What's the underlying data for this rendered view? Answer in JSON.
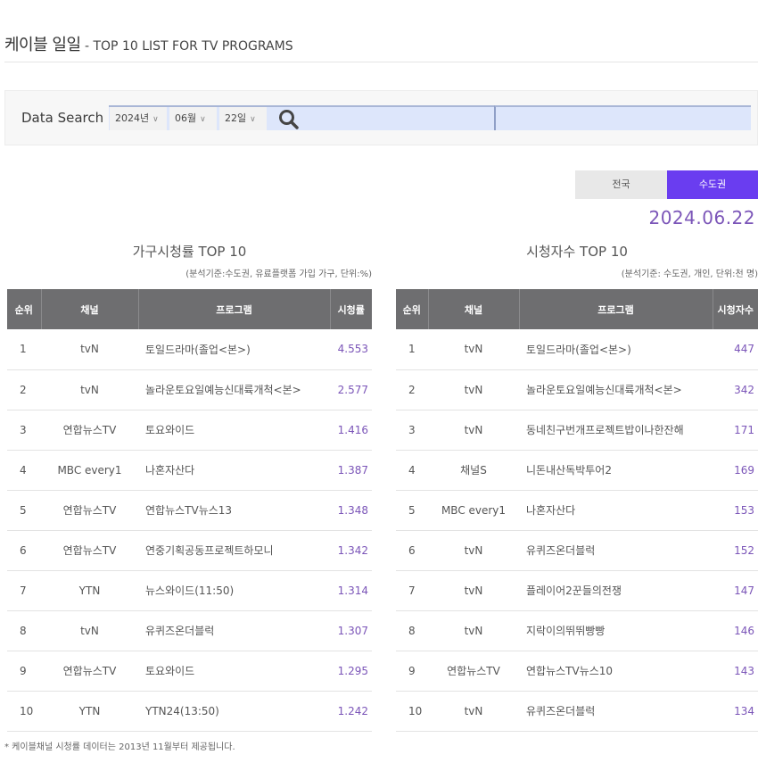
{
  "header": {
    "title_ko": "케이블 일일",
    "title_en": " - TOP 10 LIST FOR TV PROGRAMS"
  },
  "search": {
    "label": "Data Search",
    "year": "2024년",
    "month": "06월",
    "day": "22일",
    "chevron": "∨",
    "search_icon": "search-icon"
  },
  "region_tabs": [
    {
      "label": "전국",
      "active": false
    },
    {
      "label": "수도권",
      "active": true
    }
  ],
  "date_display": "2024.06.22",
  "colors": {
    "accent": "#6a3df0",
    "value_text": "#7b55b8",
    "table_header_bg": "#6e6e70",
    "search_field_bg": "#dde6fb"
  },
  "household_ratings": {
    "title": "가구시청률 TOP 10",
    "note": "(분석기준:수도권, 유료플랫폼 가입 가구, 단위:%)",
    "columns": [
      "순위",
      "채널",
      "프로그램",
      "시청률"
    ],
    "rows": [
      {
        "rank": "1",
        "channel": "tvN",
        "program": "토일드라마(졸업<본>)",
        "value": "4.553"
      },
      {
        "rank": "2",
        "channel": "tvN",
        "program": "놀라운토요일예능신대륙개척<본>",
        "value": "2.577"
      },
      {
        "rank": "3",
        "channel": "연합뉴스TV",
        "program": "토요와이드",
        "value": "1.416"
      },
      {
        "rank": "4",
        "channel": "MBC every1",
        "program": "나혼자산다",
        "value": "1.387"
      },
      {
        "rank": "5",
        "channel": "연합뉴스TV",
        "program": "연합뉴스TV뉴스13",
        "value": "1.348"
      },
      {
        "rank": "6",
        "channel": "연합뉴스TV",
        "program": "연중기획공동프로젝트하모니",
        "value": "1.342"
      },
      {
        "rank": "7",
        "channel": "YTN",
        "program": "뉴스와이드(11:50)",
        "value": "1.314"
      },
      {
        "rank": "8",
        "channel": "tvN",
        "program": "유퀴즈온더블럭",
        "value": "1.307"
      },
      {
        "rank": "9",
        "channel": "연합뉴스TV",
        "program": "토요와이드",
        "value": "1.295"
      },
      {
        "rank": "10",
        "channel": "YTN",
        "program": "YTN24(13:50)",
        "value": "1.242"
      }
    ]
  },
  "viewers": {
    "title": "시청자수 TOP 10",
    "note": "(분석기준: 수도권, 개인, 단위:천 명)",
    "columns": [
      "순위",
      "채널",
      "프로그램",
      "시청자수"
    ],
    "rows": [
      {
        "rank": "1",
        "channel": "tvN",
        "program": "토일드라마(졸업<본>)",
        "value": "447"
      },
      {
        "rank": "2",
        "channel": "tvN",
        "program": "놀라운토요일예능신대륙개척<본>",
        "value": "342"
      },
      {
        "rank": "3",
        "channel": "tvN",
        "program": "동네친구번개프로젝트밥이나한잔해",
        "value": "171"
      },
      {
        "rank": "4",
        "channel": "채널S",
        "program": "니돈내산독박투어2",
        "value": "169"
      },
      {
        "rank": "5",
        "channel": "MBC every1",
        "program": "나혼자산다",
        "value": "153"
      },
      {
        "rank": "6",
        "channel": "tvN",
        "program": "유퀴즈온더블럭",
        "value": "152"
      },
      {
        "rank": "7",
        "channel": "tvN",
        "program": "플레이어2꾼들의전쟁",
        "value": "147"
      },
      {
        "rank": "8",
        "channel": "tvN",
        "program": "지락이의뛰뛰빵빵",
        "value": "146"
      },
      {
        "rank": "9",
        "channel": "연합뉴스TV",
        "program": "연합뉴스TV뉴스10",
        "value": "143"
      },
      {
        "rank": "10",
        "channel": "tvN",
        "program": "유퀴즈온더블럭",
        "value": "134"
      }
    ]
  },
  "footnote": "* 케이블채널 시청률 데이터는 2013년 11월부터 제공됩니다."
}
